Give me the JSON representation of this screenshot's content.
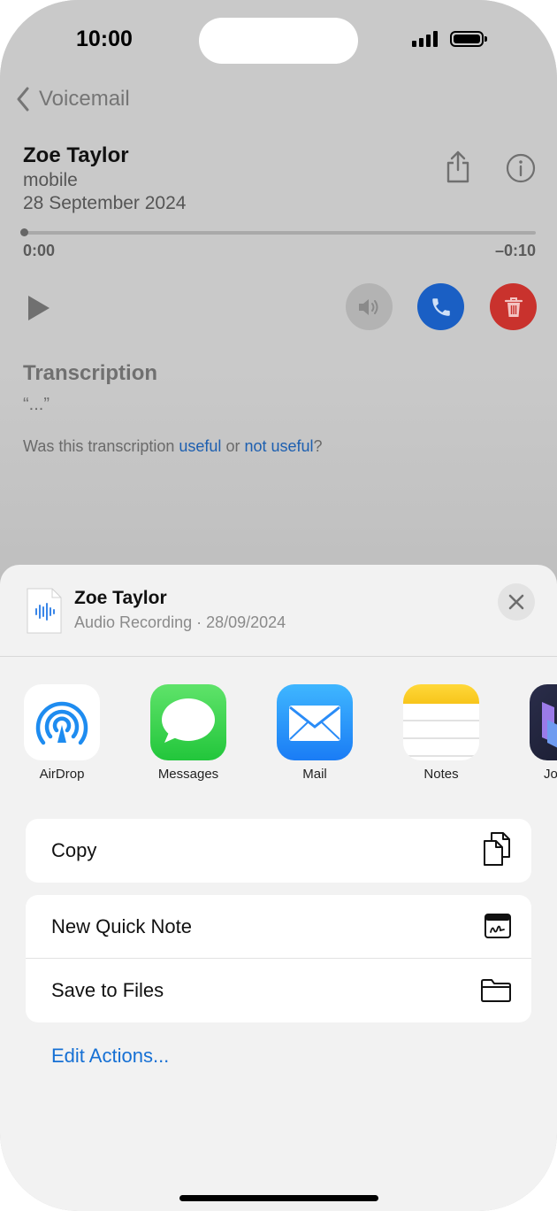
{
  "status_bar": {
    "time": "10:00"
  },
  "nav": {
    "back_label": "Voicemail"
  },
  "voicemail": {
    "name": "Zoe Taylor",
    "type": "mobile",
    "date": "28 September 2024",
    "time_elapsed": "0:00",
    "time_remaining": "–0:10",
    "progress": 0
  },
  "transcription": {
    "heading": "Transcription",
    "text": "“...”",
    "question_prefix": "Was this transcription ",
    "useful_link": "useful",
    "or_text": " or ",
    "not_useful_link": "not useful",
    "question_suffix": "?"
  },
  "share_sheet": {
    "title": "Zoe Taylor",
    "subtitle": "Audio Recording · 28/09/2024",
    "apps": [
      {
        "label": "AirDrop",
        "icon": "airdrop-icon"
      },
      {
        "label": "Messages",
        "icon": "messages-icon"
      },
      {
        "label": "Mail",
        "icon": "mail-icon"
      },
      {
        "label": "Notes",
        "icon": "notes-icon"
      },
      {
        "label": "Jo",
        "icon": "app-icon"
      }
    ],
    "actions_group1": [
      {
        "label": "Copy",
        "icon": "copy-icon"
      }
    ],
    "actions_group2": [
      {
        "label": "New Quick Note",
        "icon": "quick-note-icon"
      },
      {
        "label": "Save to Files",
        "icon": "folder-icon"
      }
    ],
    "edit_actions": "Edit Actions..."
  },
  "colors": {
    "accent_blue": "#1670d4",
    "call_button": "#1a5fc4",
    "delete_button": "#c9322d"
  }
}
